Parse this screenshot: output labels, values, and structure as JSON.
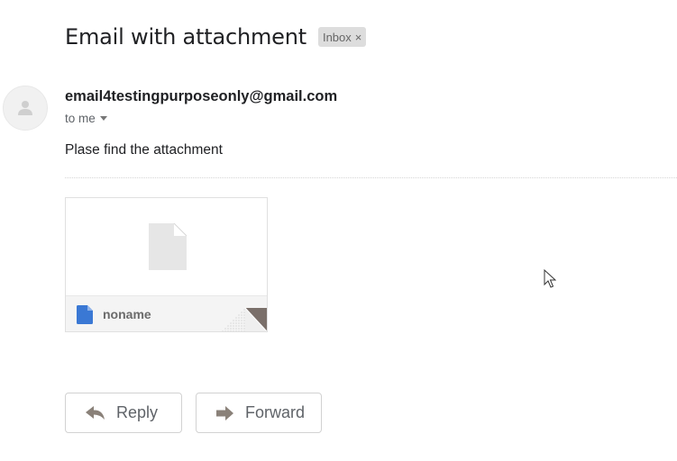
{
  "email": {
    "subject": "Email with attachment",
    "label": "Inbox",
    "label_close": "×",
    "sender": "email4testingpurposeonly@gmail.com",
    "recipient": "to me",
    "body": "Plase find the attachment"
  },
  "attachment": {
    "filename": "noname",
    "icon": "blue-document-icon",
    "preview_icon": "generic-file-icon"
  },
  "actions": {
    "reply_label": "Reply",
    "reply_icon": "reply-arrow-icon",
    "forward_label": "Forward",
    "forward_icon": "forward-arrow-icon"
  },
  "colors": {
    "chip_bg": "#dddddd",
    "attachment_icon": "#3a78d4",
    "fold": "#7a6f6a"
  }
}
